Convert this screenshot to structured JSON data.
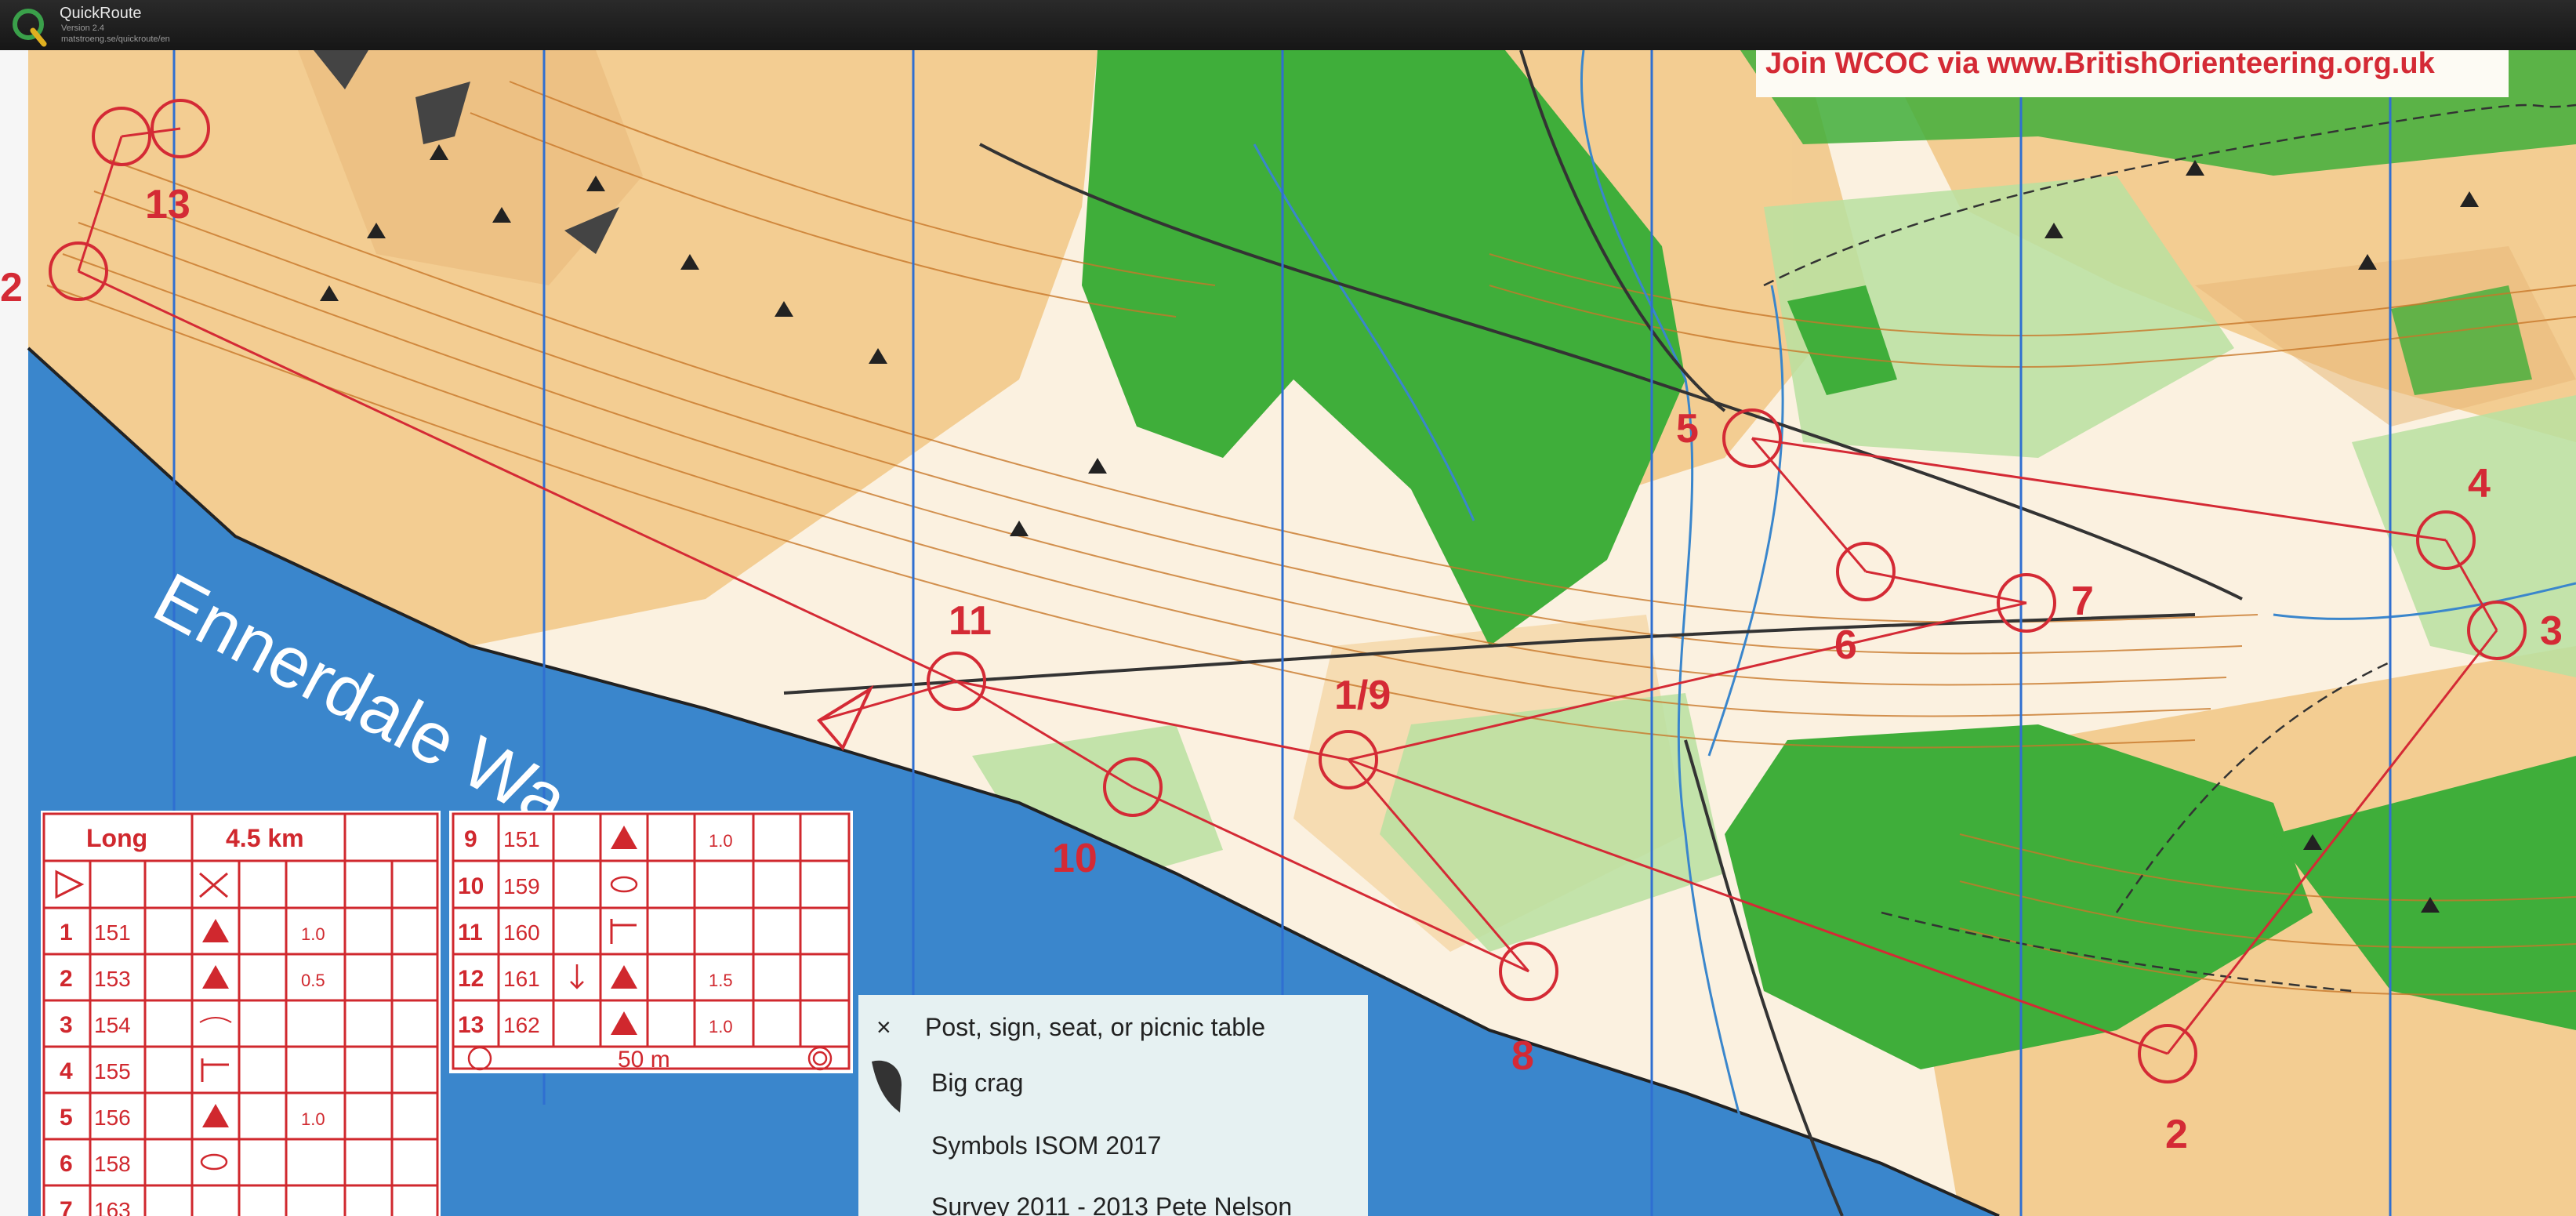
{
  "app": {
    "title": "QuickRoute",
    "version": "Version 2.4",
    "url": "matstroeng.se/quickroute/en"
  },
  "map": {
    "banner": "Join WCOC via www.BritishOrienteering.org.uk",
    "lake_label": "Ennerdale Wa",
    "controls": [
      {
        "label": "13"
      },
      {
        "label": "2"
      },
      {
        "label": "11"
      },
      {
        "label": "1/9"
      },
      {
        "label": "10"
      },
      {
        "label": "8"
      },
      {
        "label": "5"
      },
      {
        "label": "6"
      },
      {
        "label": "7"
      },
      {
        "label": "4"
      },
      {
        "label": "3"
      },
      {
        "label": "2"
      }
    ]
  },
  "control_description_left": {
    "header": {
      "course": "Long",
      "length": "4.5 km"
    },
    "rows": [
      {
        "num": "1",
        "code": "151",
        "size": "1.0"
      },
      {
        "num": "2",
        "code": "153",
        "size": "0.5"
      },
      {
        "num": "3",
        "code": "154",
        "size": ""
      },
      {
        "num": "4",
        "code": "155",
        "size": ""
      },
      {
        "num": "5",
        "code": "156",
        "size": "1.0"
      },
      {
        "num": "6",
        "code": "158",
        "size": ""
      },
      {
        "num": "7",
        "code": "163",
        "size": ""
      }
    ]
  },
  "control_description_right": {
    "rows": [
      {
        "num": "9",
        "code": "151",
        "size": "1.0"
      },
      {
        "num": "10",
        "code": "159",
        "size": ""
      },
      {
        "num": "11",
        "code": "160",
        "size": ""
      },
      {
        "num": "12",
        "code": "161",
        "size": "1.5"
      },
      {
        "num": "13",
        "code": "162",
        "size": "1.0"
      }
    ],
    "finish": "50 m"
  },
  "legend": {
    "items": [
      {
        "symbol": "×",
        "text": "Post, sign, seat, or picnic table"
      },
      {
        "symbol": "",
        "text": "Big crag"
      },
      {
        "symbol": "",
        "text": "Symbols ISOM 2017"
      },
      {
        "symbol": "",
        "text": "Survey 2011 - 2013 Pete Nelson"
      }
    ]
  },
  "colors": {
    "course": "#d42a35",
    "forest": "#3fae3a",
    "light_forest": "#b8e0a0",
    "open_land": "#f2c98a",
    "water": "#3a86cc",
    "contour": "#c8782a",
    "north_line": "#2f6fd1"
  }
}
